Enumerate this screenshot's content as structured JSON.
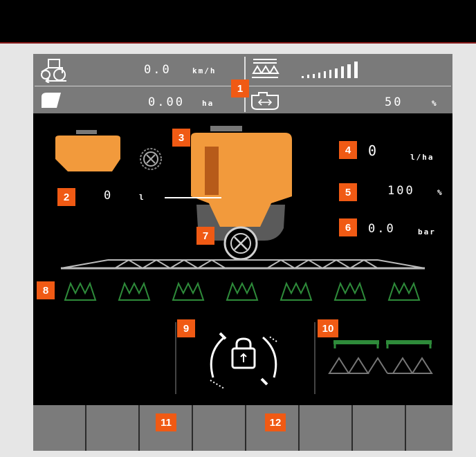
{
  "status": {
    "speed_value": "0.0",
    "speed_unit": "km/h",
    "area_value": "0.00",
    "area_unit": "ha",
    "section_percent_value": "50",
    "section_percent_unit": "%"
  },
  "tank": {
    "volume_value": "0",
    "volume_unit": "l"
  },
  "readouts": {
    "rate_value": "0",
    "rate_unit": "l/ha",
    "percent_value": "100",
    "percent_unit": "%",
    "pressure_value": "0.0",
    "pressure_unit": "bar"
  },
  "callouts": [
    "1",
    "2",
    "3",
    "4",
    "5",
    "6",
    "7",
    "8",
    "9",
    "10",
    "11",
    "12"
  ],
  "softkeys": [
    "",
    "",
    "",
    "",
    "",
    "",
    "",
    ""
  ],
  "colors": {
    "accent_orange": "#f05a14",
    "tank_orange": "#f29a3c",
    "nozzle_green": "#2e8b3a",
    "status_gray": "#7a7a7a"
  },
  "icons": [
    "tractor-speed-icon",
    "area-icon",
    "boom-sections-icon",
    "section-percent-icon",
    "lock-icon",
    "agitator-icon"
  ]
}
